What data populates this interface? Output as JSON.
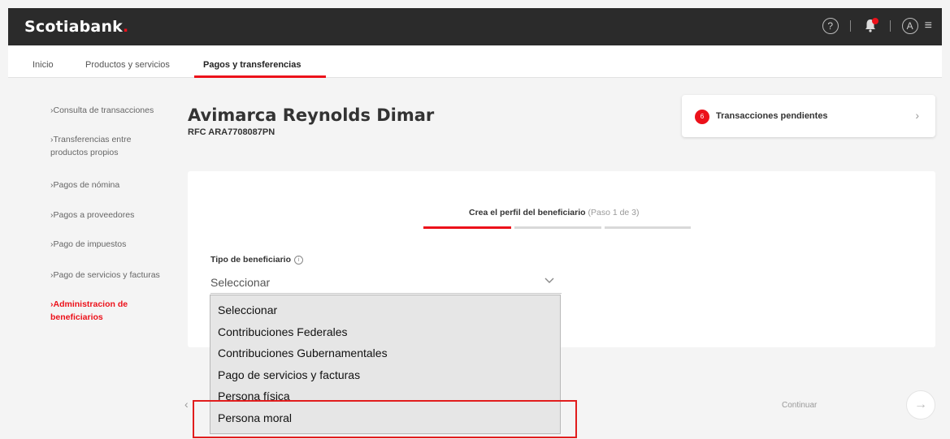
{
  "header": {
    "brand": "Scotiabank",
    "brand_dot": ".",
    "icons": [
      "help-icon",
      "notification-bell-icon",
      "user-profile-icon",
      "menu-icon"
    ],
    "help_glyph": "?",
    "user_glyph": "A",
    "menu_glyph": "≡"
  },
  "nav": {
    "items": [
      "Inicio",
      "Productos y servicios",
      "Pagos y transferencias"
    ],
    "active_index": 2
  },
  "sidebar": {
    "items": [
      {
        "label_lines": [
          "Consulta de transacciones"
        ]
      },
      {
        "label_lines": [
          "Transferencias entre",
          "productos propios"
        ]
      },
      {
        "label_lines": [
          "Pagos de nómina"
        ]
      },
      {
        "label_lines": [
          "Pagos a proveedores"
        ]
      },
      {
        "label_lines": [
          "Pago de impuestos"
        ]
      },
      {
        "label_lines": [
          "Pago de servicios y facturas"
        ]
      },
      {
        "label_lines": [
          "Administracion de",
          "beneficiarios"
        ],
        "active": true
      }
    ]
  },
  "profile": {
    "name": "Avimarca Reynolds Dimar",
    "rfc": "RFC ARA7708087PN"
  },
  "pending": {
    "count": "6",
    "label": "Transacciones pendientes",
    "chevron": "›"
  },
  "form": {
    "step_title": "Crea el perfil del beneficiario",
    "step_info": "(Paso 1 de 3)",
    "field_label": "Tipo de beneficiario",
    "info_glyph": "i",
    "selected_value": "Seleccionar",
    "caret": "⌄",
    "options": [
      "Seleccionar",
      "Contribuciones Federales",
      "Contribuciones Gubernamentales",
      "Pago de servicios y facturas",
      "Persona física",
      "Persona moral"
    ],
    "highlighted_option": "Persona moral"
  },
  "footer": {
    "back_glyph": "‹",
    "continue_label": "Continuar",
    "continue_glyph": "→"
  },
  "colors": {
    "accent": "#ec111a",
    "topbar": "#2b2b2b",
    "highlight_box": "#e11d1d"
  }
}
